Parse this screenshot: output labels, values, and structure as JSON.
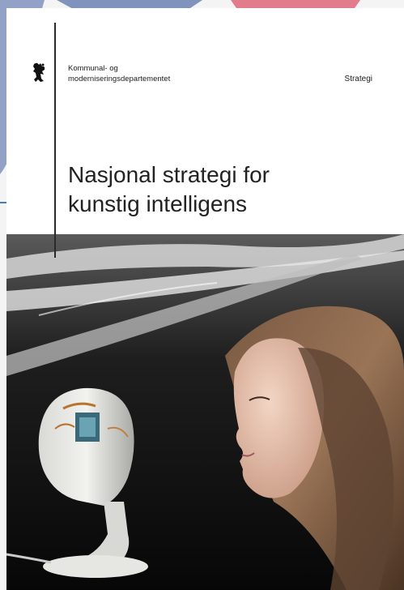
{
  "document": {
    "ministry_line1": "Kommunal- og",
    "ministry_line2": "moderniseringsdepartementet",
    "document_type": "Strategi",
    "title_line1": "Nasjonal strategi for",
    "title_line2": "kunstig intelligens"
  },
  "icons": {
    "crest": "coat-of-arms-lion-icon"
  },
  "colors": {
    "page_background": "#ffffff",
    "text": "#222222",
    "rule": "#2a2a2a",
    "photo_background": "#0d0d0d",
    "decor_blue": "#7f93bd",
    "decor_pink": "#e27c8c"
  }
}
